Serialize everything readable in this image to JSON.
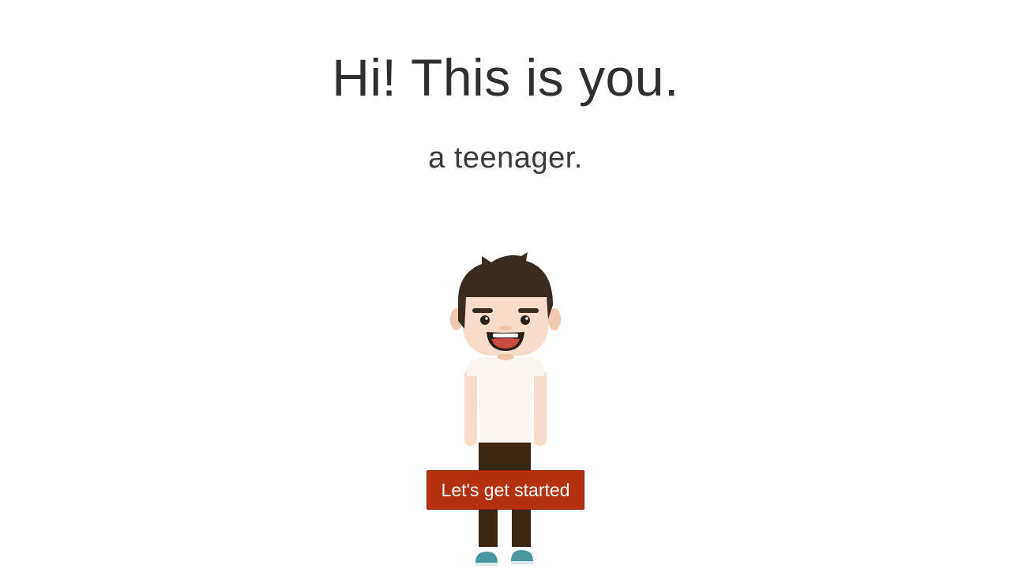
{
  "headline": "Hi! This is you.",
  "subline": "a teenager.",
  "avatar": {
    "icon": "teenager-avatar-icon",
    "colors": {
      "hair": "#3a2b20",
      "skin": "#f8dccb",
      "shirt": "#faf5ef",
      "pants": "#3b2614",
      "shoes": "#4a97a0",
      "mouth": "#c94a3e"
    }
  },
  "cta": {
    "label": "Let's get started",
    "color": "#b5300e"
  }
}
